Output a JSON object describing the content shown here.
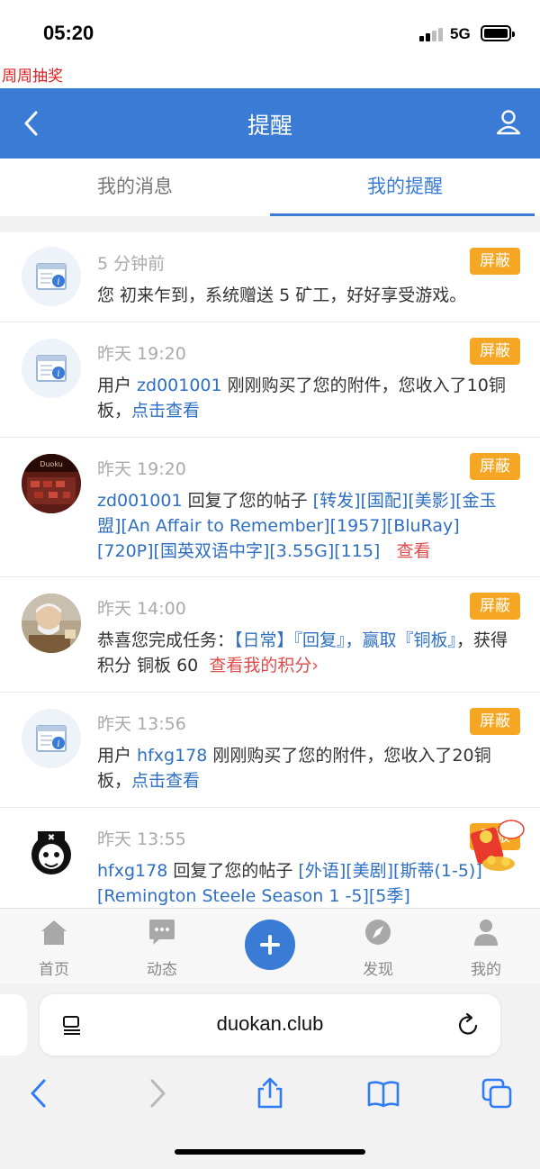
{
  "status": {
    "time": "05:20",
    "network": "5G"
  },
  "promo": "周周抽奖",
  "header": {
    "title": "提醒"
  },
  "tabs": [
    {
      "label": "我的消息"
    },
    {
      "label": "我的提醒"
    }
  ],
  "block_label": "屏蔽",
  "items": [
    {
      "time": "5 分钟前",
      "text": "您 初来乍到，系统赠送 5 矿工，好好享受游戏。"
    },
    {
      "time": "昨天 19:20",
      "text_pre": "用户 ",
      "user": "zd001001",
      "text_mid": " 刚刚购买了您的附件，您收入了10铜板，",
      "link": "点击查看"
    },
    {
      "time": "昨天 19:20",
      "user": "zd001001",
      "text_mid": " 回复了您的帖子 ",
      "link": "[转发][国配][美影][金玉盟][An Affair to Remember][1957][BluRay][720P][国英双语中字][3.55G][115]",
      "action": "查看"
    },
    {
      "time": "昨天 14:00",
      "text_pre": "恭喜您完成任务：",
      "task": "【日常】『回复』，赢取『铜板』",
      "text_mid": "，获得积分 铜板 60",
      "action": "查看我的积分›"
    },
    {
      "time": "昨天 13:56",
      "text_pre": "用户 ",
      "user": "hfxg178",
      "text_mid": " 刚刚购买了您的附件，您收入了20铜板，",
      "link": "点击查看"
    },
    {
      "time": "昨天 13:55",
      "user": "hfxg178",
      "text_mid": " 回复了您的帖子 ",
      "link": "[外语][美剧][斯蒂(1-5)][Remington Steele Season 1 -5][5季]"
    }
  ],
  "nav": [
    {
      "label": "首页"
    },
    {
      "label": "动态"
    },
    {
      "label": "发现"
    },
    {
      "label": "我的"
    }
  ],
  "browser": {
    "url": "duokan.club"
  },
  "colors": {
    "accent": "#3a7bd5",
    "block": "#f5a623",
    "link": "#2e6fc2",
    "alert": "#e04a4a"
  }
}
